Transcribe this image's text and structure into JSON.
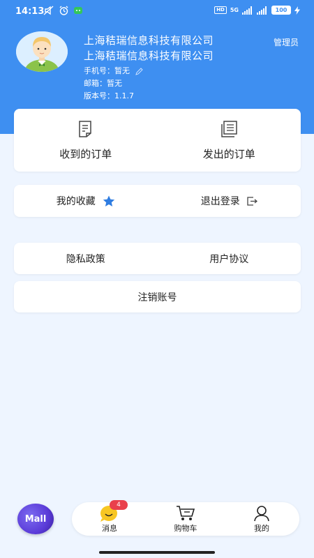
{
  "status_bar": {
    "time": "14:13",
    "network": "5G",
    "battery": "100"
  },
  "profile": {
    "company_line_1": "上海秸瑞信息科技有限公司",
    "company_line_2": "上海秸瑞信息科技有限公司",
    "phone": "手机号：暂无",
    "email": "邮箱：暂无",
    "version": "版本号：1.1.7",
    "role": "管理员"
  },
  "orders": {
    "received": "收到的订单",
    "sent": "发出的订单"
  },
  "actions": {
    "favorites": "我的收藏",
    "logout": "退出登录"
  },
  "policies": {
    "privacy": "隐私政策",
    "agreement": "用户协议"
  },
  "account": {
    "cancel": "注销账号"
  },
  "bottom_nav": {
    "logo_text": "Mall",
    "messages_label": "消息",
    "messages_badge": "4",
    "cart_label": "购物车",
    "mine_label": "我的"
  },
  "colors": {
    "header": "#3e8ff1",
    "background": "#eef5ff",
    "star": "#2f7de1",
    "badge": "#e9404c"
  }
}
